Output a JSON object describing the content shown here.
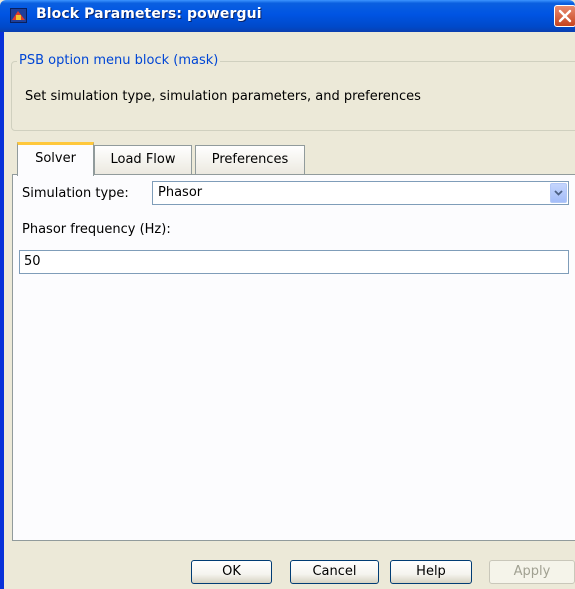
{
  "window": {
    "title": "Block Parameters: powergui",
    "icon": "simulink-block-icon",
    "close_icon": "close-icon"
  },
  "group": {
    "legend": "PSB option menu block (mask)",
    "description": "Set simulation type, simulation parameters, and preferences"
  },
  "tabs": [
    {
      "label": "Solver",
      "active": true
    },
    {
      "label": "Load Flow",
      "active": false
    },
    {
      "label": "Preferences",
      "active": false
    }
  ],
  "solver": {
    "simulation_type_label": "Simulation type:",
    "simulation_type_value": "Phasor",
    "phasor_frequency_label": "Phasor frequency (Hz):",
    "phasor_frequency_value": "50"
  },
  "buttons": {
    "ok": "OK",
    "cancel": "Cancel",
    "help": "Help",
    "apply": "Apply",
    "apply_enabled": false
  },
  "colors": {
    "titlebar": "#0054e3",
    "dialog_bg": "#ece9d8",
    "group_legend": "#0046d5",
    "active_tab_highlight": "#ffc83c"
  }
}
